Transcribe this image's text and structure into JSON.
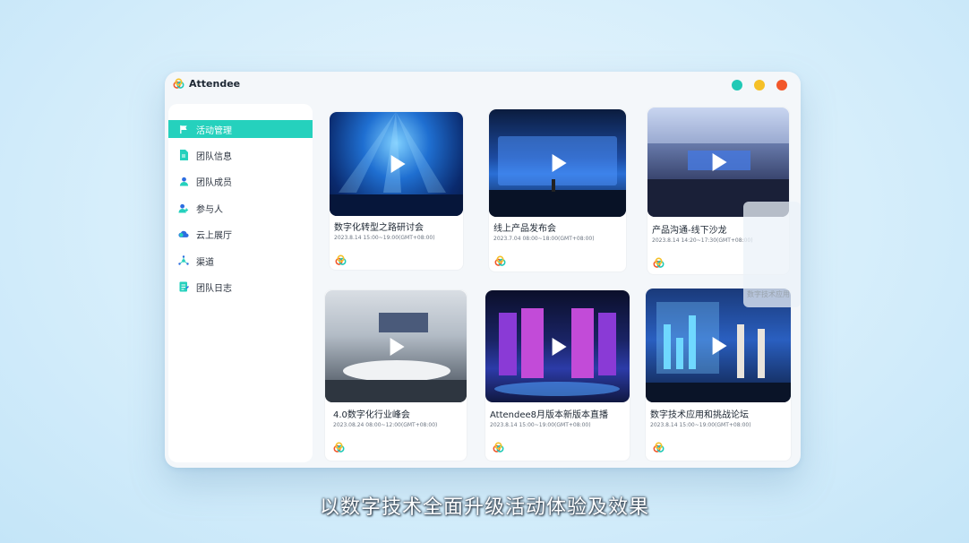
{
  "window": {
    "app_name": "Attendee",
    "traffic_lights": [
      "#20c9b6",
      "#f5c027",
      "#f2572a"
    ]
  },
  "sidebar": {
    "items": [
      {
        "label": "活动管理",
        "icon": "flag-icon",
        "active": true
      },
      {
        "label": "团队信息",
        "icon": "document-icon",
        "active": false
      },
      {
        "label": "团队成员",
        "icon": "person-icon",
        "active": false
      },
      {
        "label": "参与人",
        "icon": "user-add-icon",
        "active": false
      },
      {
        "label": "云上展厅",
        "icon": "cloud-icon",
        "active": false
      },
      {
        "label": "渠道",
        "icon": "network-icon",
        "active": false
      },
      {
        "label": "团队日志",
        "icon": "log-icon",
        "active": false
      }
    ]
  },
  "events": [
    {
      "title": "数字化转型之路研讨会",
      "time": "2023.8.14 15:00~19:00(GMT+08:00)"
    },
    {
      "title": "线上产品发布会",
      "time": "2023.7.04 08:00~18:00(GMT+08:00)"
    },
    {
      "title": "产品沟通-线下沙龙",
      "time": "2023.8.14 14:20~17:30(GMT+08:00)"
    },
    {
      "title": "4.0数字化行业峰会",
      "time": "2023.08.24 08:00~12:00(GMT+08:00)"
    },
    {
      "title": "Attendee8月版本新版本直播",
      "time": "2023.8.14 15:00~19:00(GMT+08:00)"
    },
    {
      "title": "数字技术应用和挑战论坛",
      "time": "2023.8.14 15:00~19:00(GMT+08:00)"
    }
  ],
  "ghost_card_text": "数字技术应用",
  "caption": "以数字技术全面升级活动体验及效果",
  "colors": {
    "accent": "#25d1bd"
  }
}
